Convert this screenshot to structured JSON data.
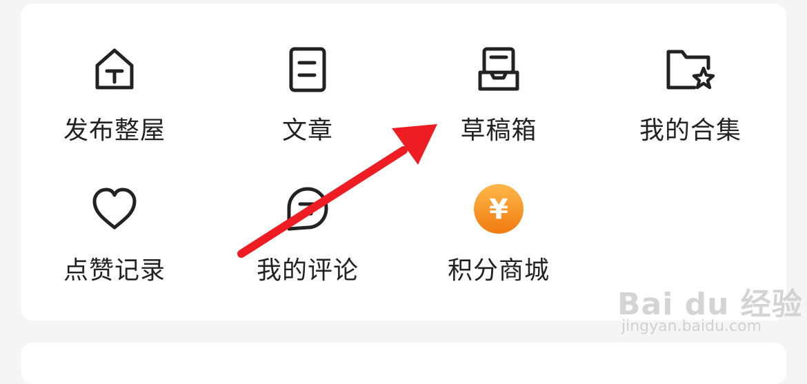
{
  "menu": {
    "items": [
      {
        "label": "发布整屋",
        "icon": "house-icon"
      },
      {
        "label": "文章",
        "icon": "article-icon"
      },
      {
        "label": "草稿箱",
        "icon": "drafts-box-icon"
      },
      {
        "label": "我的合集",
        "icon": "folder-star-icon"
      },
      {
        "label": "点赞记录",
        "icon": "heart-icon"
      },
      {
        "label": "我的评论",
        "icon": "comment-icon"
      },
      {
        "label": "积分商城",
        "icon": "yen-coin-icon"
      }
    ]
  },
  "coin": {
    "symbol": "¥"
  },
  "colors": {
    "background": "#f5f5f5",
    "card": "#ffffff",
    "text": "#222222",
    "icon_stroke": "#222222",
    "arrow": "#ee1d23",
    "coin_top": "#ffb84a",
    "coin_bottom": "#f07a10"
  },
  "watermark": {
    "brand": "Bai du 经验",
    "url": "jingyan.baidu.com"
  }
}
